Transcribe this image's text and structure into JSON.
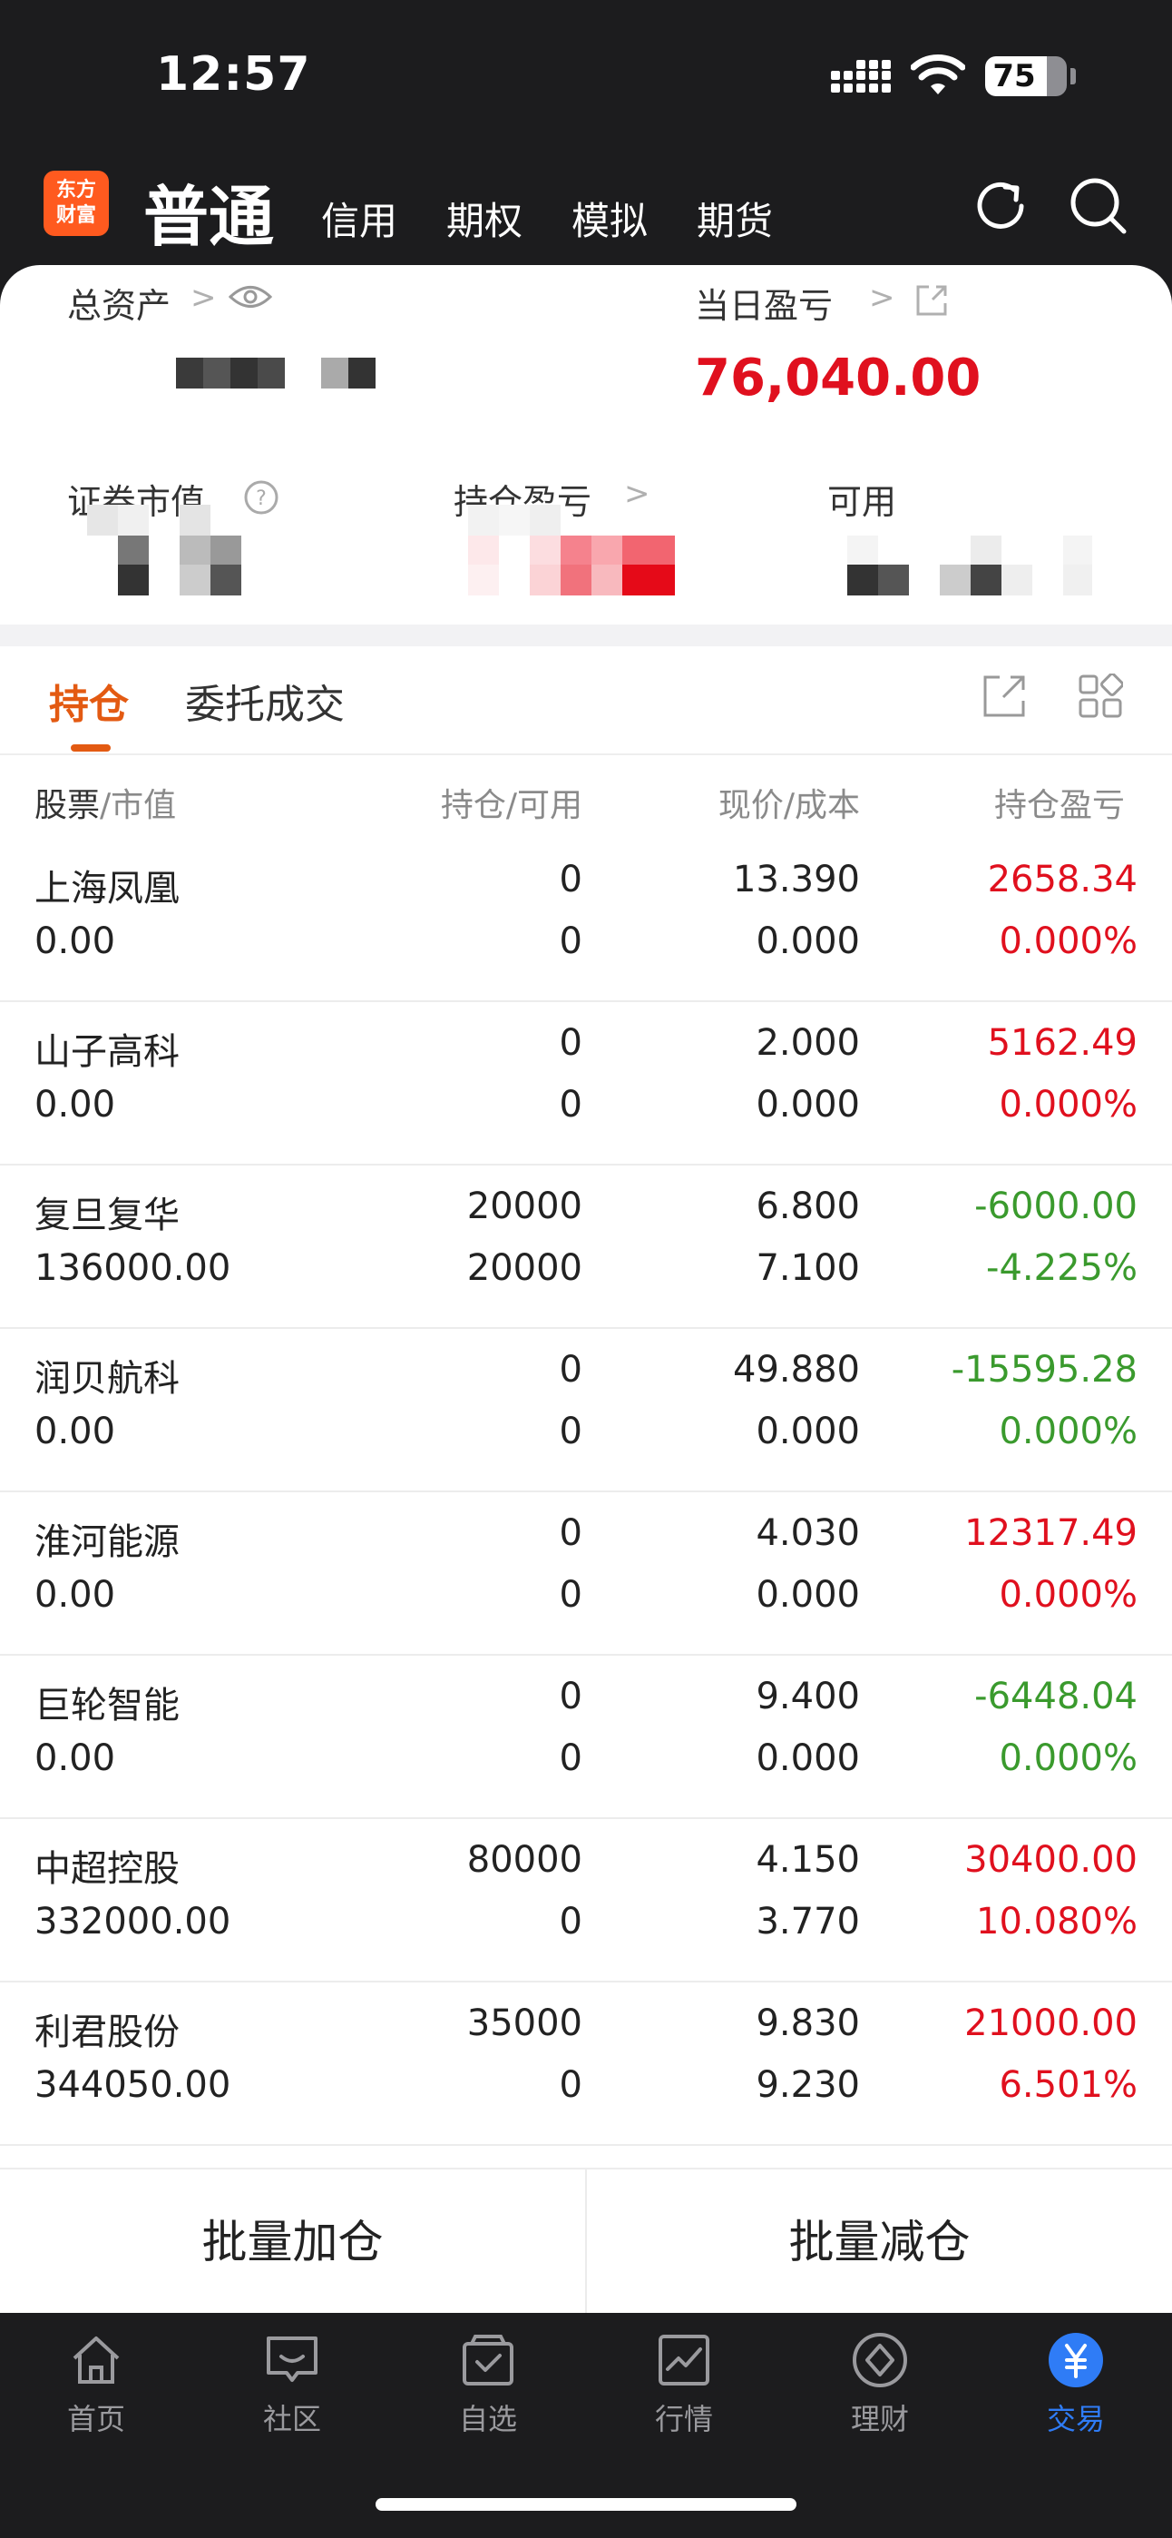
{
  "status_bar": {
    "time": "12:57",
    "battery": "75",
    "battery_level": 0.75
  },
  "header": {
    "logo_line1": "东方",
    "logo_line2": "财富",
    "active_tab": "普通",
    "tabs": [
      "信用",
      "期权",
      "模拟",
      "期货"
    ]
  },
  "summary": {
    "total_assets_label": "总资产",
    "daily_pnl_label": "当日盈亏",
    "daily_pnl_value": "76,040.00",
    "market_value_label": "证券市值",
    "position_pnl_label": "持仓盈亏",
    "available_label": "可用"
  },
  "tabs": {
    "holdings": "持仓",
    "orders": "委托成交"
  },
  "columns": {
    "stock": "股票",
    "market_value": "市值",
    "position": "持仓",
    "available": "可用",
    "price": "现价",
    "cost": "成本",
    "pnl": "持仓盈亏"
  },
  "holdings": [
    {
      "name": "上海凤凰",
      "market_value": "0.00",
      "position": "0",
      "available": "0",
      "price": "13.390",
      "cost": "0.000",
      "pnl": "2658.34",
      "pct": "0.000%",
      "trend": "up"
    },
    {
      "name": "山子高科",
      "market_value": "0.00",
      "position": "0",
      "available": "0",
      "price": "2.000",
      "cost": "0.000",
      "pnl": "5162.49",
      "pct": "0.000%",
      "trend": "up"
    },
    {
      "name": "复旦复华",
      "market_value": "136000.00",
      "position": "20000",
      "available": "20000",
      "price": "6.800",
      "cost": "7.100",
      "pnl": "-6000.00",
      "pct": "-4.225%",
      "trend": "down"
    },
    {
      "name": "润贝航科",
      "market_value": "0.00",
      "position": "0",
      "available": "0",
      "price": "49.880",
      "cost": "0.000",
      "pnl": "-15595.28",
      "pct": "0.000%",
      "trend": "down"
    },
    {
      "name": "淮河能源",
      "market_value": "0.00",
      "position": "0",
      "available": "0",
      "price": "4.030",
      "cost": "0.000",
      "pnl": "12317.49",
      "pct": "0.000%",
      "trend": "up"
    },
    {
      "name": "巨轮智能",
      "market_value": "0.00",
      "position": "0",
      "available": "0",
      "price": "9.400",
      "cost": "0.000",
      "pnl": "-6448.04",
      "pct": "0.000%",
      "trend": "down"
    },
    {
      "name": "中超控股",
      "market_value": "332000.00",
      "position": "80000",
      "available": "0",
      "price": "4.150",
      "cost": "3.770",
      "pnl": "30400.00",
      "pct": "10.080%",
      "trend": "up"
    },
    {
      "name": "利君股份",
      "market_value": "344050.00",
      "position": "35000",
      "available": "0",
      "price": "9.830",
      "cost": "9.230",
      "pnl": "21000.00",
      "pct": "6.501%",
      "trend": "up"
    }
  ],
  "batch": {
    "add": "批量加仓",
    "reduce": "批量减仓"
  },
  "nav": [
    {
      "label": "首页",
      "icon": "home-icon"
    },
    {
      "label": "社区",
      "icon": "chat-icon"
    },
    {
      "label": "自选",
      "icon": "watchlist-icon"
    },
    {
      "label": "行情",
      "icon": "chart-icon"
    },
    {
      "label": "理财",
      "icon": "diamond-icon"
    },
    {
      "label": "交易",
      "icon": "yuan-icon",
      "active": true
    }
  ],
  "colors": {
    "brand": "#ff5a1f",
    "accent": "#e35a12",
    "up": "#e0101e",
    "down": "#3a9a2d",
    "nav_active": "#2f7cf6"
  }
}
